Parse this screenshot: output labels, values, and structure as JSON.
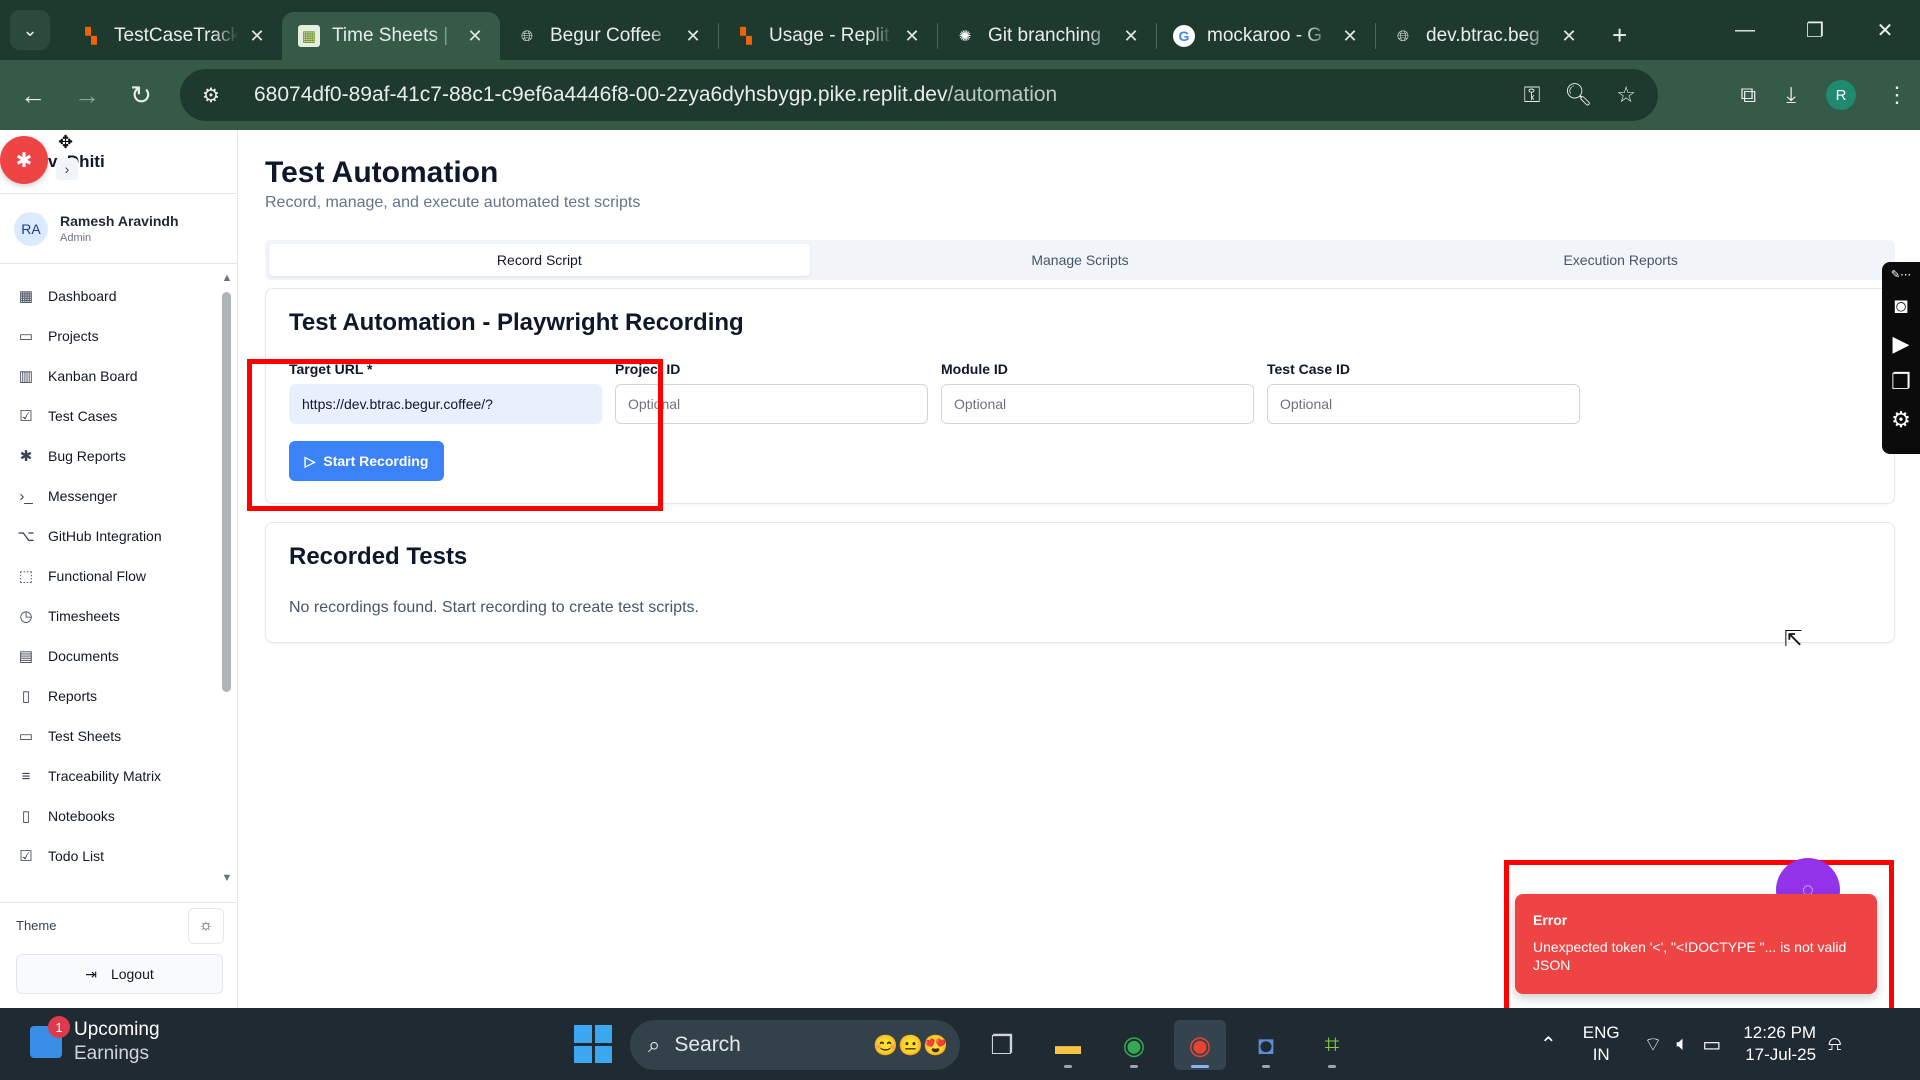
{
  "browser": {
    "tabs": [
      {
        "title": "TestCaseTrack",
        "icon": "replit-icon",
        "active": false
      },
      {
        "title": "Time Sheets |",
        "icon": "app-icon",
        "active": true
      },
      {
        "title": "Begur Coffee",
        "icon": "globe-icon",
        "active": false
      },
      {
        "title": "Usage - Replit",
        "icon": "replit-icon",
        "active": false
      },
      {
        "title": "Git branching",
        "icon": "openai-icon",
        "active": false
      },
      {
        "title": "mockaroo - G",
        "icon": "google-icon",
        "active": false
      },
      {
        "title": "dev.btrac.beg",
        "icon": "globe-icon",
        "active": false
      }
    ],
    "url_host": "68074df0-89af-41c7-88c1-c9ef6a4446f8-00-2zya6dyhsbygp.pike.replit.dev",
    "url_path": "/automation",
    "profile_initial": "R"
  },
  "sidebar": {
    "brand": "vaDhiti",
    "user": {
      "initials": "RA",
      "name": "Ramesh Aravindh",
      "role": "Admin"
    },
    "items": [
      {
        "label": "Dashboard",
        "icon": "grid-icon"
      },
      {
        "label": "Projects",
        "icon": "folder-icon"
      },
      {
        "label": "Kanban Board",
        "icon": "kanban-icon"
      },
      {
        "label": "Test Cases",
        "icon": "checkbox-icon"
      },
      {
        "label": "Bug Reports",
        "icon": "bug-icon"
      },
      {
        "label": "Messenger",
        "icon": "terminal-icon"
      },
      {
        "label": "GitHub Integration",
        "icon": "github-icon"
      },
      {
        "label": "Functional Flow",
        "icon": "flow-icon"
      },
      {
        "label": "Timesheets",
        "icon": "clock-icon"
      },
      {
        "label": "Documents",
        "icon": "document-icon"
      },
      {
        "label": "Reports",
        "icon": "report-icon"
      },
      {
        "label": "Test Sheets",
        "icon": "sheet-icon"
      },
      {
        "label": "Traceability Matrix",
        "icon": "filter-icon"
      },
      {
        "label": "Notebooks",
        "icon": "notebook-icon"
      },
      {
        "label": "Todo List",
        "icon": "todo-icon"
      }
    ],
    "theme_label": "Theme",
    "logout_label": "Logout"
  },
  "page": {
    "title": "Test Automation",
    "subtitle": "Record, manage, and execute automated test scripts",
    "tabs": [
      "Record Script",
      "Manage Scripts",
      "Execution Reports"
    ],
    "active_tab": "Record Script"
  },
  "recording": {
    "title": "Test Automation - Playwright Recording",
    "fields": {
      "target_url": {
        "label": "Target URL *",
        "value": "https://dev.btrac.begur.coffee/?"
      },
      "project_id": {
        "label": "Project ID",
        "placeholder": "Optional"
      },
      "module_id": {
        "label": "Module ID",
        "placeholder": "Optional"
      },
      "test_case_id": {
        "label": "Test Case ID",
        "placeholder": "Optional"
      }
    },
    "start_button": "Start Recording"
  },
  "recorded": {
    "title": "Recorded Tests",
    "empty": "No recordings found. Start recording to create test scripts."
  },
  "toast": {
    "title": "Error",
    "message": "Unexpected token '<', \"<!DOCTYPE \"... is not valid JSON"
  },
  "taskbar": {
    "weather_badge": "1",
    "weather_title": "Upcoming",
    "weather_sub": "Earnings",
    "search_label": "Search",
    "lang_top": "ENG",
    "lang_bottom": "IN",
    "time": "12:26 PM",
    "date": "17-Jul-25"
  },
  "colors": {
    "accent": "#3b82f6",
    "error": "#ef4444",
    "annotation": "#ff0000",
    "chrome": "#355a48"
  }
}
